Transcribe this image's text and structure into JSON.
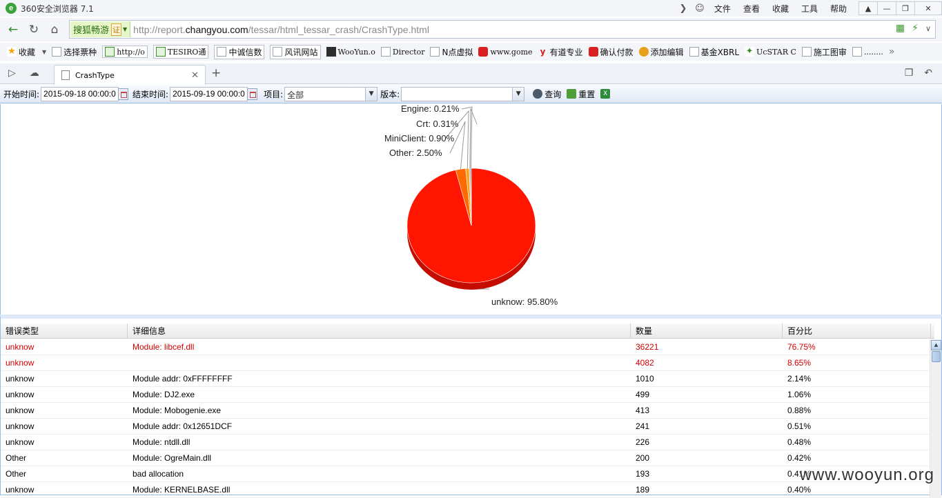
{
  "browser": {
    "app_title": "360安全浏览器 7.1",
    "menus": [
      "文件",
      "查看",
      "收藏",
      "工具",
      "帮助"
    ]
  },
  "address_bar": {
    "badge_text": "搜狐畅游",
    "badge_cert": "证",
    "url_prefix": "http://report.",
    "url_host": "changyou.com",
    "url_path": "/tessar/html_tessar_crash/CrashType.html"
  },
  "bookmarks": [
    "收藏",
    "选择票种",
    "http://o",
    "TESIRO通",
    "中诚信数",
    "风讯网站",
    "WooYun.o",
    "Director",
    "N点虚拟",
    "www.gome",
    "有道专业",
    "确认付款",
    "添加编辑",
    "基金XBRL",
    "UcSTAR C",
    "施工图审",
    "........"
  ],
  "tab": {
    "label": "CrashType"
  },
  "toolbar": {
    "start_label": "开始时间:",
    "start_value": "2015-09-18 00:00:0",
    "end_label": "结束时间:",
    "end_value": "2015-09-19 00:00:0",
    "project_label": "项目:",
    "project_value": "全部",
    "version_label": "版本:",
    "version_value": "",
    "query_label": "查询",
    "reset_label": "重置"
  },
  "chart_data": {
    "type": "pie",
    "slices": [
      {
        "label": "unknow",
        "value": 95.8,
        "color": "#ff1500"
      },
      {
        "label": "Other",
        "value": 2.5,
        "color": "#ff6a00"
      },
      {
        "label": "MiniClient",
        "value": 0.9,
        "color": "#f5a623"
      },
      {
        "label": "Crt",
        "value": 0.31,
        "color": "#b0b0b0"
      },
      {
        "label": "Engine",
        "value": 0.21,
        "color": "#444444"
      }
    ],
    "labels": [
      "Engine: 0.21%",
      "Crt: 0.31%",
      "MiniClient: 0.90%",
      "Other: 2.50%",
      "unknow: 95.80%"
    ]
  },
  "grid": {
    "columns": [
      "错误类型",
      "详细信息",
      "数量",
      "百分比"
    ],
    "rows": [
      {
        "type": "unknow",
        "detail": "Module: libcef.dll",
        "count": "36221",
        "percent": "76.75%",
        "highlight": true
      },
      {
        "type": "unknow",
        "detail": "",
        "count": "4082",
        "percent": "8.65%",
        "highlight": true
      },
      {
        "type": "unknow",
        "detail": "Module addr: 0xFFFFFFFF",
        "count": "1010",
        "percent": "2.14%",
        "highlight": false
      },
      {
        "type": "unknow",
        "detail": "Module: DJ2.exe",
        "count": "499",
        "percent": "1.06%",
        "highlight": false
      },
      {
        "type": "unknow",
        "detail": "Module: Mobogenie.exe",
        "count": "413",
        "percent": "0.88%",
        "highlight": false
      },
      {
        "type": "unknow",
        "detail": "Module addr: 0x12651DCF",
        "count": "241",
        "percent": "0.51%",
        "highlight": false
      },
      {
        "type": "unknow",
        "detail": "Module: ntdll.dll",
        "count": "226",
        "percent": "0.48%",
        "highlight": false
      },
      {
        "type": "Other",
        "detail": "Module: OgreMain.dll",
        "count": "200",
        "percent": "0.42%",
        "highlight": false
      },
      {
        "type": "Other",
        "detail": "bad allocation",
        "count": "193",
        "percent": "0.41%",
        "highlight": false
      },
      {
        "type": "unknow",
        "detail": "Module: KERNELBASE.dll",
        "count": "189",
        "percent": "0.40%",
        "highlight": false
      }
    ]
  },
  "watermark": "www.wooyun.org"
}
